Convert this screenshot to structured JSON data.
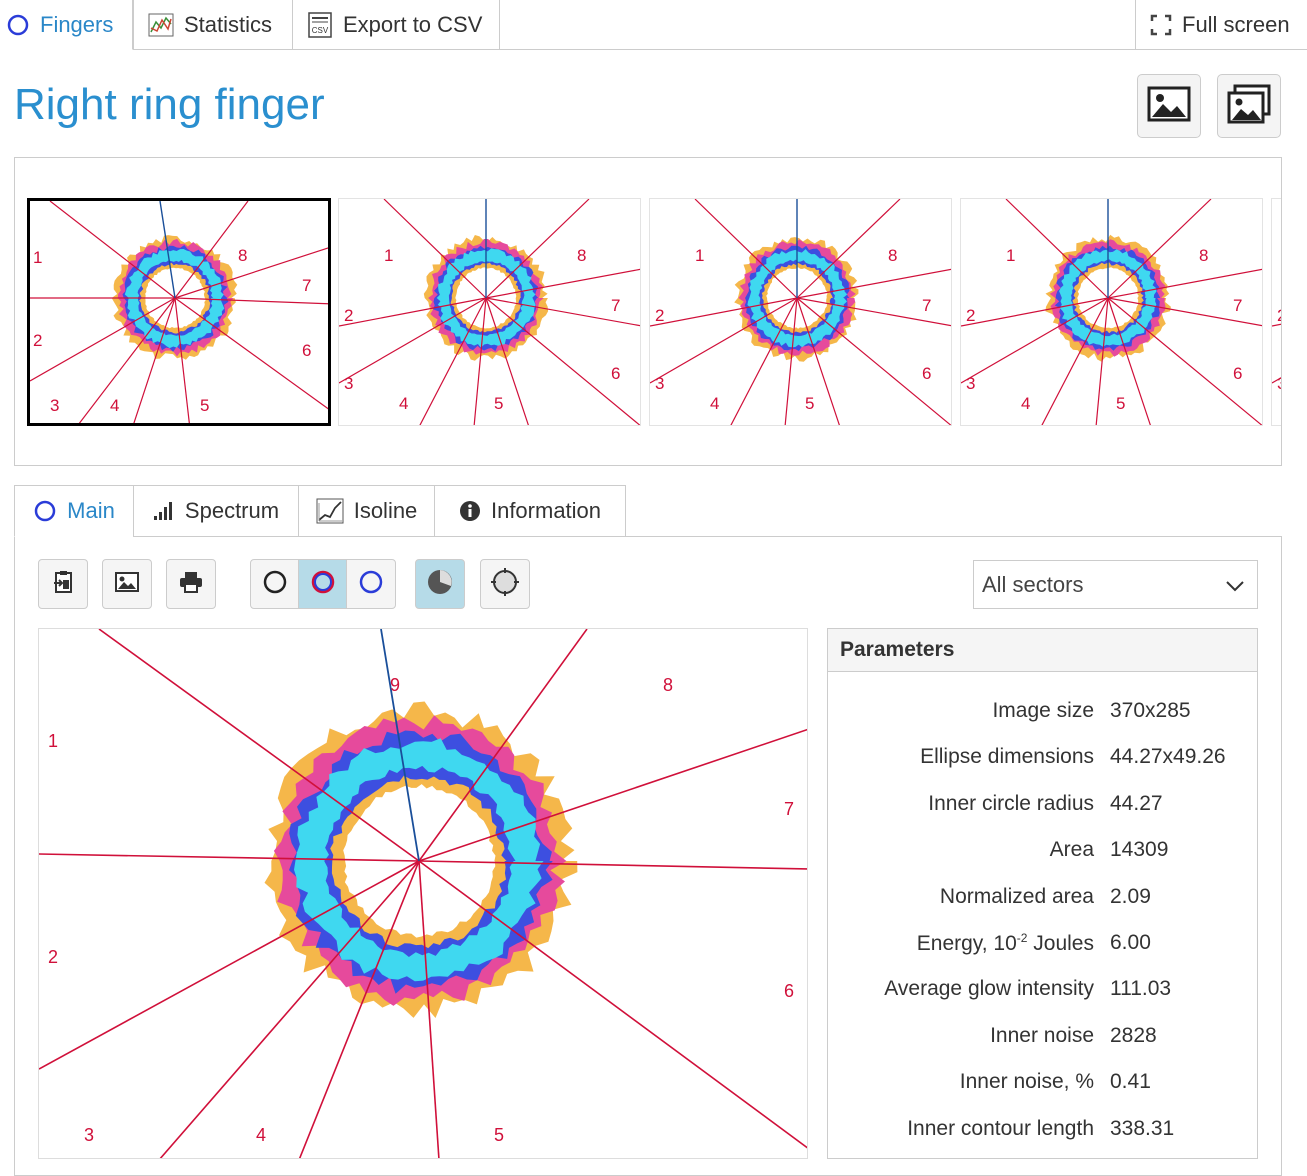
{
  "top_tabs": {
    "fingers": "Fingers",
    "statistics": "Statistics",
    "export_csv": "Export to CSV",
    "fullscreen": "Full screen"
  },
  "page_title": "Right ring finger",
  "thumbnails": {
    "sector_labels": [
      "1",
      "2",
      "3",
      "4",
      "5",
      "6",
      "7",
      "8"
    ]
  },
  "sub_tabs": {
    "main": "Main",
    "spectrum": "Spectrum",
    "isoline": "Isoline",
    "information": "Information"
  },
  "toolbar": {
    "sector_select": "All sectors"
  },
  "main_image": {
    "sector_labels": [
      "1",
      "2",
      "3",
      "4",
      "5",
      "6",
      "7",
      "8",
      "9"
    ]
  },
  "parameters": {
    "title": "Parameters",
    "rows": [
      {
        "label": "Image size",
        "value": "370x285"
      },
      {
        "label": "Ellipse dimensions",
        "value": "44.27x49.26"
      },
      {
        "label": "Inner circle radius",
        "value": "44.27"
      },
      {
        "label": "Area",
        "value": "14309"
      },
      {
        "label": "Normalized area",
        "value": "2.09"
      },
      {
        "label": "Energy, 10",
        "label_sup": "-2",
        "label_suffix": " Joules",
        "value": "6.00"
      },
      {
        "label": "Average glow intensity",
        "value": "111.03"
      },
      {
        "label": "Inner noise",
        "value": "2828"
      },
      {
        "label": "Inner noise, %",
        "value": "0.41"
      },
      {
        "label": "Inner contour length",
        "value": "338.31"
      }
    ]
  },
  "colors": {
    "accent": "#2a87c8",
    "sector_line": "#d0103a",
    "axis_line": "#1a4f9a",
    "glow_outer": "#f5b74a",
    "glow_mid": "#e64a9c",
    "glow_blue": "#3d4fe0",
    "glow_cyan": "#3fd8f0"
  }
}
